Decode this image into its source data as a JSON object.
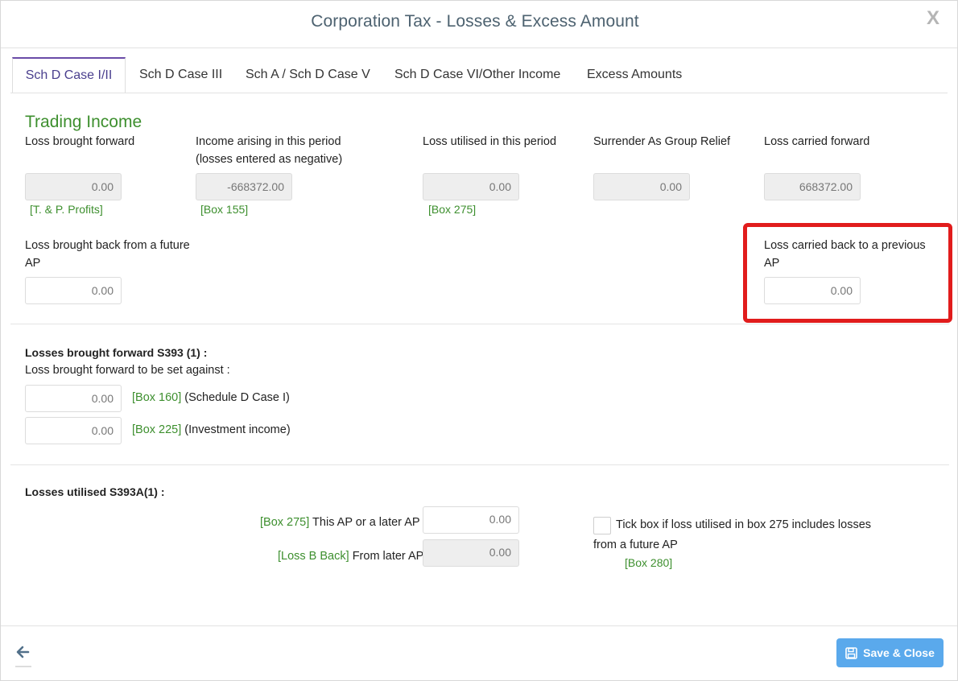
{
  "dialog": {
    "title": "Corporation Tax - Losses & Excess Amount",
    "close_label": "X"
  },
  "tabs": [
    {
      "label": "Sch D Case I/II",
      "active": true
    },
    {
      "label": "Sch D Case III",
      "active": false
    },
    {
      "label": "Sch A / Sch D Case V",
      "active": false
    },
    {
      "label": "Sch D Case VI/Other Income",
      "active": false
    },
    {
      "label": "Excess Amounts",
      "active": false
    }
  ],
  "trading": {
    "section_title": "Trading Income",
    "loss_bf": {
      "label": "Loss brought forward",
      "value": "0.00",
      "ref": "[T. & P. Profits]"
    },
    "income_arising": {
      "label_line1": "Income arising in this period",
      "label_line2": "(losses entered as negative)",
      "value": "-668372.00",
      "ref": "[Box 155]"
    },
    "loss_utilised": {
      "label": "Loss utilised in this period",
      "value": "0.00",
      "ref": "[Box 275]"
    },
    "surrender": {
      "label": "Surrender As Group Relief",
      "value": "0.00"
    },
    "loss_cf": {
      "label": "Loss carried forward",
      "value": "668372.00"
    },
    "loss_bb": {
      "label_line1": "Loss brought back from a future",
      "label_line2": "AP",
      "value": "0.00"
    },
    "loss_cb": {
      "label_line1": "Loss carried back to a previous",
      "label_line2": "AP",
      "value": "0.00"
    }
  },
  "s393": {
    "heading": "Losses brought forward S393 (1) :",
    "subheading": "Loss brought forward to be set against  :",
    "rows": [
      {
        "value": "0.00",
        "ref": "[Box 160]",
        "text": "(Schedule D Case I)"
      },
      {
        "value": "0.00",
        "ref": "[Box 225]",
        "text": "(Investment income)"
      }
    ]
  },
  "s393a": {
    "heading": "Losses utilised S393A(1) :",
    "this_ap": {
      "ref": "[Box 275]",
      "text": "This AP or a later AP",
      "value": "0.00"
    },
    "later_ap": {
      "ref": "[Loss B Back]",
      "text": "From later AP",
      "value": "0.00"
    },
    "tick_line1": "Tick box if loss utilised in box 275 includes losses",
    "tick_line2": "from a future AP",
    "tick_ref": "[Box 280]",
    "tick_checked": false
  },
  "footer": {
    "save_label": "Save & Close"
  },
  "colors": {
    "accent_green": "#3d8f2e",
    "tab_active": "#6a4ba8",
    "save_button": "#5aa9ec",
    "highlight": "#e11c1c"
  }
}
